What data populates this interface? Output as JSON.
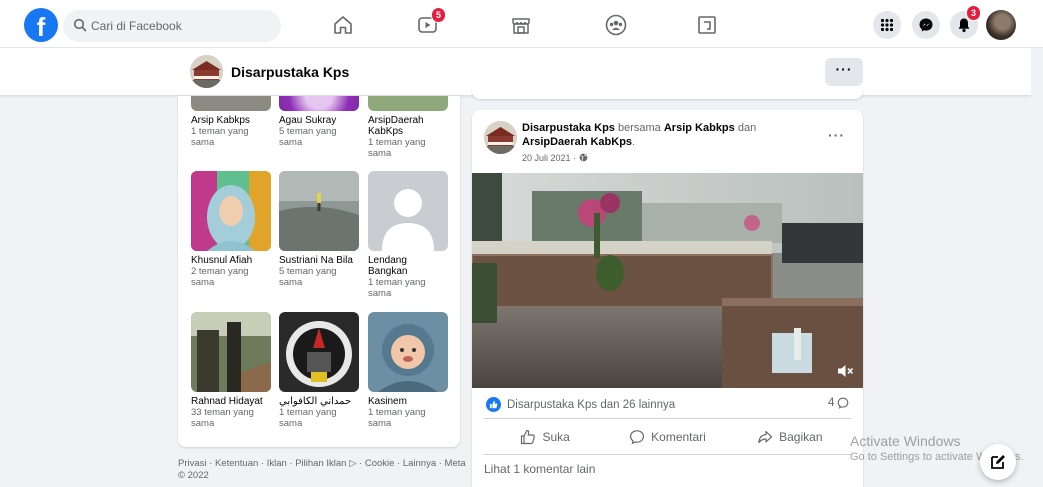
{
  "nav": {
    "logo": "f",
    "search_placeholder": "Cari di Facebook",
    "video_badge": "5",
    "notifications_badge": "3",
    "icons": [
      "home-icon",
      "video-icon",
      "marketplace-icon",
      "groups-icon",
      "gaming-icon",
      "menu-grid-icon",
      "messenger-icon",
      "bell-icon"
    ]
  },
  "page": {
    "name": "Disarpustaka Kps",
    "more_label": "···"
  },
  "friends": [
    {
      "name": "Arsip Kabkps",
      "mutual": "1 teman yang sama"
    },
    {
      "name": "Agau Sukray",
      "mutual": "5 teman yang sama"
    },
    {
      "name": "ArsipDaerah KabKps",
      "mutual": "1 teman yang sama"
    },
    {
      "name": "Khusnul Afiah",
      "mutual": "2 teman yang sama"
    },
    {
      "name": "Sustriani Na Bila",
      "mutual": "5 teman yang sama"
    },
    {
      "name": "Lendang Bangkan",
      "mutual": "1 teman yang sama"
    },
    {
      "name": "Rahnad Hidayat",
      "mutual": "33 teman yang sama"
    },
    {
      "name": "حمداني الكافوابي",
      "mutual": "1 teman yang sama"
    },
    {
      "name": "Kasinem",
      "mutual": "1 teman yang sama"
    }
  ],
  "footer": {
    "text": "Privasi · Ketentuan · Iklan · Pilihan Iklan ▷ · Cookie · Lainnya · Meta © 2022"
  },
  "post": {
    "author": "Disarpustaka Kps",
    "with_word": "bersama",
    "tag1": "Arsip Kabkps",
    "and_word": "dan",
    "tag2": "ArsipDaerah KabKps",
    "period": ".",
    "date": "20 Juli 2021 ·",
    "more": "···",
    "reactions_text": "Disarpustaka Kps dan 26 lainnya",
    "comments_count": "4",
    "like_label": "Suka",
    "comment_label": "Komentari",
    "share_label": "Bagikan",
    "more_comments": "Lihat 1 komentar lain"
  },
  "watermark": {
    "line1": "Activate Windows",
    "line2": "Go to Settings to activate Windows."
  }
}
